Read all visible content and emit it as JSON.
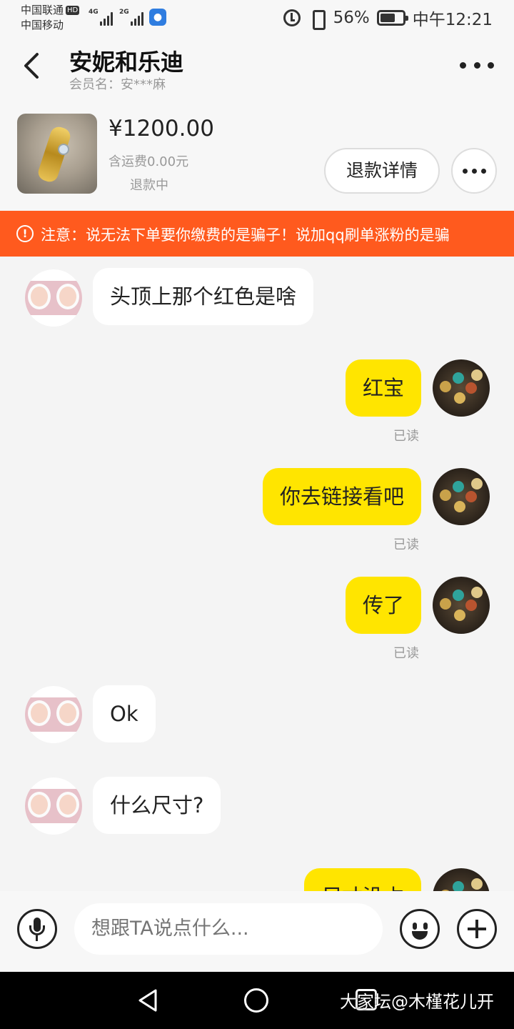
{
  "status_bar": {
    "carrier1": "中国联通",
    "hd_badge": "HD",
    "carrier2": "中国移动",
    "net1": "4G",
    "net2": "2G",
    "battery_pct": "56%",
    "time": "中午12:21",
    "icons": [
      "signal-icon",
      "bulb-icon",
      "alarm-icon",
      "vibrate-icon",
      "battery-icon"
    ]
  },
  "header": {
    "title": "安妮和乐迪",
    "member": "会员名：安***麻"
  },
  "product": {
    "price": "¥1200.00",
    "shipping": "含运费0.00元",
    "status": "退款中",
    "refund_button": "退款详情"
  },
  "warning": {
    "icon": "!",
    "text": "注意：说无法下单要你缴费的是骗子！说加qq刷单涨粉的是骗"
  },
  "messages": [
    {
      "from": "other",
      "text": "头顶上那个红色是啥"
    },
    {
      "from": "me",
      "text": "红宝",
      "status": "已读"
    },
    {
      "from": "me",
      "text": "你去链接看吧",
      "status": "已读"
    },
    {
      "from": "me",
      "text": "传了",
      "status": "已读"
    },
    {
      "from": "other",
      "text": "Ok"
    },
    {
      "from": "other",
      "text": "什么尺寸?"
    },
    {
      "from": "me",
      "text": "尺寸没占"
    }
  ],
  "input": {
    "placeholder": "想跟TA说点什么..."
  },
  "watermark": "大家坛@木槿花儿开",
  "colors": {
    "accent_yellow": "#ffe500",
    "warning_orange": "#ff5a1e",
    "background": "#f4f4f4"
  }
}
